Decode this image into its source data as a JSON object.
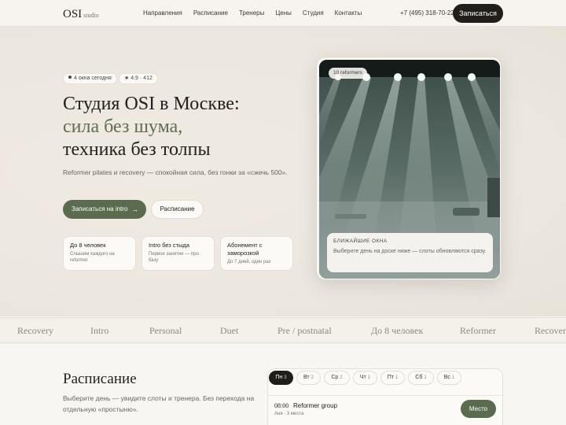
{
  "header": {
    "logo": "OSI",
    "logo_suffix": "studio",
    "nav": [
      "Направления",
      "Расписание",
      "Тренеры",
      "Цены",
      "Студия",
      "Контакты"
    ],
    "phone": "+7 (495) 318-70-22",
    "cta": "Записаться"
  },
  "hero": {
    "badge_windows": "4 окна сегодня",
    "badge_rating": "★ 4.9 · 412",
    "title_line1": "Студия OSI в Москве:",
    "title_line2": "сила без шума,",
    "title_line3": "техника без толпы",
    "lead": "Reformer pilates и recovery — спокойная сила, без гонки за «сжечь 500».",
    "primary_button": "Записаться на intro",
    "primary_arrow": "→",
    "secondary_button": "Расписание",
    "cards": [
      {
        "title": "До 8 человек",
        "subtitle": "Слышим каждого на reformer"
      },
      {
        "title": "Intro без стыда",
        "subtitle": "Первое занятие — про базу"
      },
      {
        "title": "Абонемент с заморозкой",
        "subtitle": "До 7 дней, один раз"
      }
    ],
    "photo_badge": "10 reformers",
    "slots_caption": "БЛИЖАЙШИЕ ОКНА",
    "slots_text": "Выберите день на доске ниже — слоты обновляются сразу."
  },
  "marquee": [
    "Recovery",
    "Intro",
    "Personal",
    "Duet",
    "Pre / postnatal",
    "До 8 человек",
    "Reformer",
    "Recovery"
  ],
  "schedule": {
    "title": "Расписание",
    "description": "Выберите день — увидите слоты и тренера. Без перехода на отдельную «простыню».",
    "days": [
      {
        "label": "Пн",
        "count": "3",
        "active": true
      },
      {
        "label": "Вт",
        "count": "2",
        "active": false
      },
      {
        "label": "Ср",
        "count": "2",
        "active": false
      },
      {
        "label": "Чт",
        "count": "1",
        "active": false
      },
      {
        "label": "Пт",
        "count": "1",
        "active": false
      },
      {
        "label": "Сб",
        "count": "1",
        "active": false
      },
      {
        "label": "Вс",
        "count": "1",
        "active": false
      }
    ],
    "slot": {
      "time": "08:00",
      "name": "Reformer group",
      "meta": "Аня · 3 места",
      "button": "Место"
    }
  },
  "colors": {
    "accent_green": "#5b6b4d",
    "dark": "#1f1e1b",
    "background": "#f4f1eb"
  }
}
